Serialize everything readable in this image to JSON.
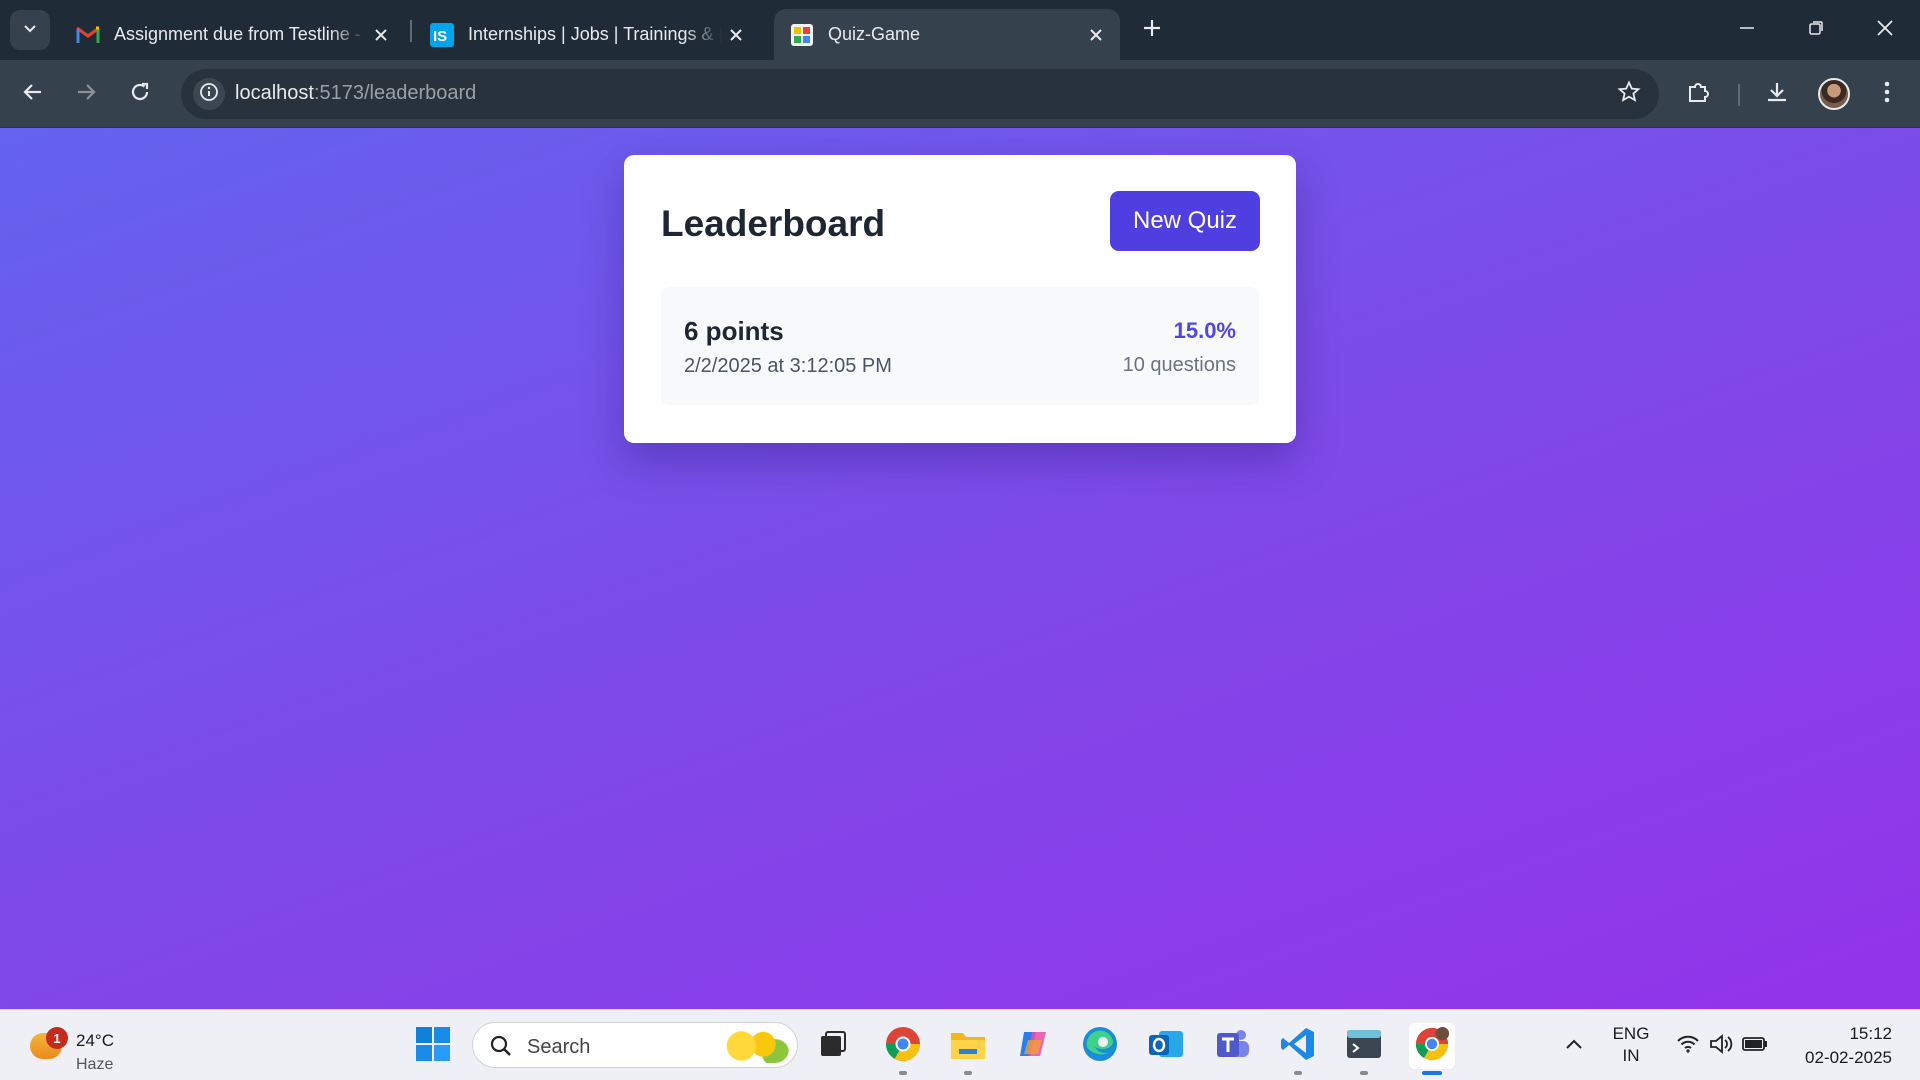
{
  "browser": {
    "tabs": [
      {
        "title": "Assignment due from Testline -",
        "favicon": "gmail-icon",
        "active": false
      },
      {
        "title": "Internships | Jobs | Trainings & |",
        "favicon": "internshala-icon",
        "active": false
      },
      {
        "title": "Quiz-Game",
        "favicon": "quiz-game-icon",
        "active": true
      }
    ],
    "address": {
      "host": "localhost",
      "path": ":5173/leaderboard"
    }
  },
  "page": {
    "title": "Leaderboard",
    "new_quiz_label": "New Quiz",
    "entries": [
      {
        "points": "6 points",
        "date": "2/2/2025 at 3:12:05 PM",
        "percent": "15.0%",
        "questions": "10 questions"
      }
    ]
  },
  "taskbar": {
    "weather": {
      "temp": "24°C",
      "condition": "Haze",
      "badge": "1"
    },
    "search_label": "Search",
    "apps": [
      "start-icon",
      "search-icon",
      "task-view-icon",
      "chrome-icon",
      "file-explorer-icon",
      "copilot-icon",
      "edge-icon",
      "outlook-icon",
      "teams-icon",
      "vscode-icon",
      "terminal-icon",
      "chrome-profile-icon"
    ],
    "tray": {
      "lang_top": "ENG",
      "lang_bottom": "IN"
    },
    "clock": {
      "time": "15:12",
      "date": "02-02-2025"
    }
  },
  "colors": {
    "accent": "#4f3fe0",
    "percent": "#4f46e5",
    "gradient_start": "#6462ee",
    "gradient_end": "#9333ea"
  }
}
